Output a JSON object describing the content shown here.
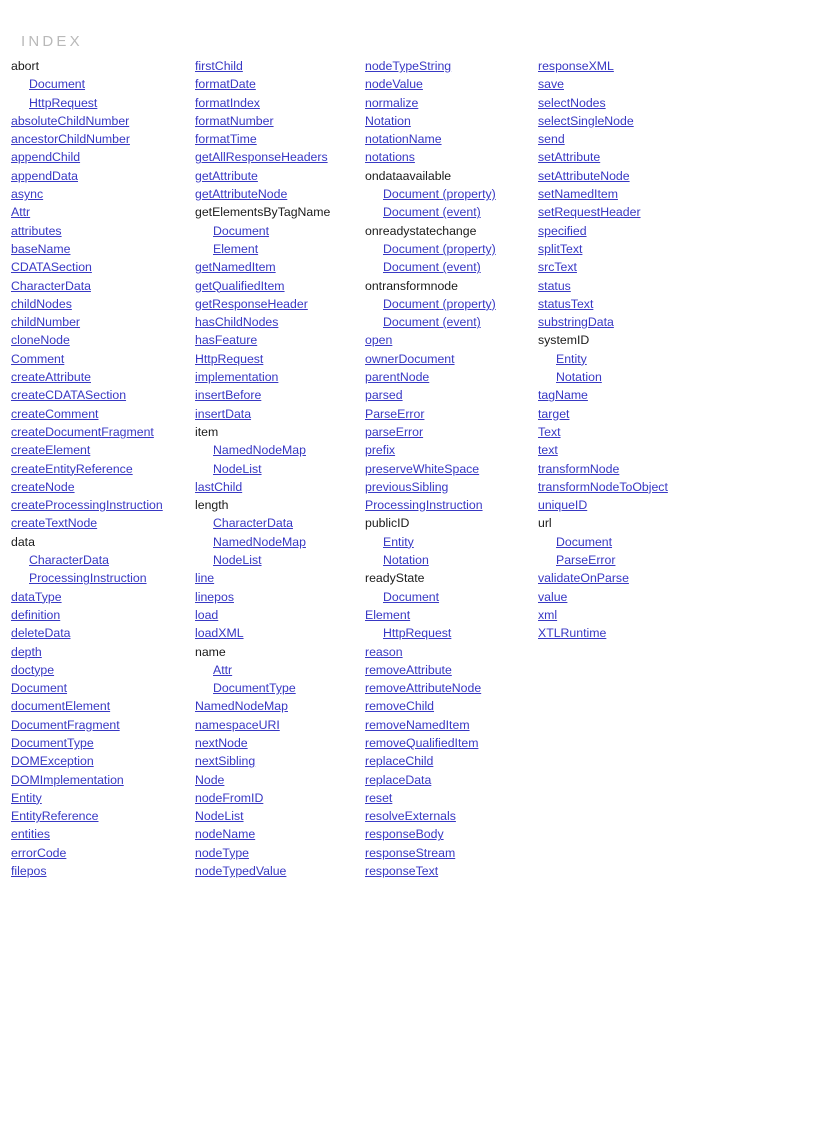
{
  "page": {
    "title": "INDEX",
    "link_color": "#3838c4",
    "text_color": "#1a1a1a",
    "title_color": "#b9b9b9",
    "background_color": "#ffffff"
  },
  "columns": [
    {
      "name": "column-1",
      "entries": [
        {
          "label": "abort",
          "link": false,
          "indent": 0
        },
        {
          "label": "Document",
          "link": true,
          "indent": 1
        },
        {
          "label": "HttpRequest",
          "link": true,
          "indent": 1
        },
        {
          "label": "absoluteChildNumber",
          "link": true,
          "indent": 0
        },
        {
          "label": "ancestorChildNumber",
          "link": true,
          "indent": 0
        },
        {
          "label": "appendChild",
          "link": true,
          "indent": 0
        },
        {
          "label": "appendData",
          "link": true,
          "indent": 0
        },
        {
          "label": "async",
          "link": true,
          "indent": 0
        },
        {
          "label": "Attr",
          "link": true,
          "indent": 0
        },
        {
          "label": "attributes",
          "link": true,
          "indent": 0
        },
        {
          "label": "baseName",
          "link": true,
          "indent": 0
        },
        {
          "label": "CDATASection",
          "link": true,
          "indent": 0
        },
        {
          "label": "CharacterData",
          "link": true,
          "indent": 0
        },
        {
          "label": "childNodes",
          "link": true,
          "indent": 0
        },
        {
          "label": "childNumber",
          "link": true,
          "indent": 0
        },
        {
          "label": "cloneNode",
          "link": true,
          "indent": 0
        },
        {
          "label": "Comment",
          "link": true,
          "indent": 0
        },
        {
          "label": "createAttribute",
          "link": true,
          "indent": 0
        },
        {
          "label": "createCDATASection",
          "link": true,
          "indent": 0
        },
        {
          "label": "createComment",
          "link": true,
          "indent": 0
        },
        {
          "label": "createDocumentFragment",
          "link": true,
          "indent": 0
        },
        {
          "label": "createElement",
          "link": true,
          "indent": 0
        },
        {
          "label": "createEntityReference",
          "link": true,
          "indent": 0
        },
        {
          "label": "createNode",
          "link": true,
          "indent": 0
        },
        {
          "label": "createProcessingInstruction",
          "link": true,
          "indent": 0
        },
        {
          "label": "createTextNode",
          "link": true,
          "indent": 0
        },
        {
          "label": "data",
          "link": false,
          "indent": 0
        },
        {
          "label": "CharacterData",
          "link": true,
          "indent": 1
        },
        {
          "label": "ProcessingInstruction",
          "link": true,
          "indent": 1
        },
        {
          "label": "dataType",
          "link": true,
          "indent": 0
        },
        {
          "label": "definition",
          "link": true,
          "indent": 0
        },
        {
          "label": "deleteData",
          "link": true,
          "indent": 0
        },
        {
          "label": "depth",
          "link": true,
          "indent": 0
        },
        {
          "label": "doctype",
          "link": true,
          "indent": 0
        },
        {
          "label": "Document",
          "link": true,
          "indent": 0
        },
        {
          "label": "documentElement",
          "link": true,
          "indent": 0
        },
        {
          "label": "DocumentFragment",
          "link": true,
          "indent": 0
        },
        {
          "label": "DocumentType",
          "link": true,
          "indent": 0
        },
        {
          "label": "DOMException",
          "link": true,
          "indent": 0
        },
        {
          "label": "DOMImplementation",
          "link": true,
          "indent": 0
        },
        {
          "label": "Entity",
          "link": true,
          "indent": 0
        },
        {
          "label": "EntityReference",
          "link": true,
          "indent": 0
        },
        {
          "label": "entities",
          "link": true,
          "indent": 0
        },
        {
          "label": "errorCode",
          "link": true,
          "indent": 0
        },
        {
          "label": "filepos",
          "link": true,
          "indent": 0
        }
      ]
    },
    {
      "name": "column-2",
      "entries": [
        {
          "label": "firstChild",
          "link": true,
          "indent": 0
        },
        {
          "label": "formatDate",
          "link": true,
          "indent": 0
        },
        {
          "label": "formatIndex",
          "link": true,
          "indent": 0
        },
        {
          "label": "formatNumber",
          "link": true,
          "indent": 0
        },
        {
          "label": "formatTime",
          "link": true,
          "indent": 0
        },
        {
          "label": "getAllResponseHeaders",
          "link": true,
          "indent": 0
        },
        {
          "label": "getAttribute",
          "link": true,
          "indent": 0
        },
        {
          "label": "getAttributeNode",
          "link": true,
          "indent": 0
        },
        {
          "label": "getElementsByTagName",
          "link": false,
          "indent": 0
        },
        {
          "label": "Document",
          "link": true,
          "indent": 1
        },
        {
          "label": "Element",
          "link": true,
          "indent": 1
        },
        {
          "label": "getNamedItem",
          "link": true,
          "indent": 0
        },
        {
          "label": "getQualifiedItem",
          "link": true,
          "indent": 0
        },
        {
          "label": "getResponseHeader",
          "link": true,
          "indent": 0
        },
        {
          "label": "hasChildNodes",
          "link": true,
          "indent": 0
        },
        {
          "label": "hasFeature",
          "link": true,
          "indent": 0
        },
        {
          "label": "HttpRequest",
          "link": true,
          "indent": 0
        },
        {
          "label": "implementation",
          "link": true,
          "indent": 0
        },
        {
          "label": "insertBefore",
          "link": true,
          "indent": 0
        },
        {
          "label": "insertData",
          "link": true,
          "indent": 0
        },
        {
          "label": "item",
          "link": false,
          "indent": 0
        },
        {
          "label": "NamedNodeMap",
          "link": true,
          "indent": 1
        },
        {
          "label": "NodeList",
          "link": true,
          "indent": 1
        },
        {
          "label": "lastChild",
          "link": true,
          "indent": 0
        },
        {
          "label": "length",
          "link": false,
          "indent": 0
        },
        {
          "label": "CharacterData",
          "link": true,
          "indent": 1
        },
        {
          "label": "NamedNodeMap",
          "link": true,
          "indent": 1
        },
        {
          "label": "NodeList",
          "link": true,
          "indent": 1
        },
        {
          "label": "line",
          "link": true,
          "indent": 0
        },
        {
          "label": "linepos",
          "link": true,
          "indent": 0
        },
        {
          "label": "load",
          "link": true,
          "indent": 0
        },
        {
          "label": "loadXML",
          "link": true,
          "indent": 0
        },
        {
          "label": "name",
          "link": false,
          "indent": 0
        },
        {
          "label": "Attr",
          "link": true,
          "indent": 1
        },
        {
          "label": "DocumentType",
          "link": true,
          "indent": 1
        },
        {
          "label": "NamedNodeMap",
          "link": true,
          "indent": 0
        },
        {
          "label": "namespaceURI",
          "link": true,
          "indent": 0
        },
        {
          "label": "nextNode",
          "link": true,
          "indent": 0
        },
        {
          "label": "nextSibling",
          "link": true,
          "indent": 0
        },
        {
          "label": "Node",
          "link": true,
          "indent": 0
        },
        {
          "label": "nodeFromID",
          "link": true,
          "indent": 0
        },
        {
          "label": "NodeList",
          "link": true,
          "indent": 0
        },
        {
          "label": "nodeName",
          "link": true,
          "indent": 0
        },
        {
          "label": "nodeType",
          "link": true,
          "indent": 0
        },
        {
          "label": "nodeTypedValue",
          "link": true,
          "indent": 0
        }
      ]
    },
    {
      "name": "column-3",
      "entries": [
        {
          "label": "nodeTypeString",
          "link": true,
          "indent": 0
        },
        {
          "label": "nodeValue",
          "link": true,
          "indent": 0
        },
        {
          "label": "normalize",
          "link": true,
          "indent": 0
        },
        {
          "label": "Notation",
          "link": true,
          "indent": 0
        },
        {
          "label": "notationName",
          "link": true,
          "indent": 0
        },
        {
          "label": "notations",
          "link": true,
          "indent": 0
        },
        {
          "label": "ondataavailable",
          "link": false,
          "indent": 0
        },
        {
          "label": "Document (property)",
          "link": true,
          "indent": 1
        },
        {
          "label": "Document (event)",
          "link": true,
          "indent": 1
        },
        {
          "label": "onreadystatechange",
          "link": false,
          "indent": 0
        },
        {
          "label": "Document (property)",
          "link": true,
          "indent": 1
        },
        {
          "label": "Document (event)",
          "link": true,
          "indent": 1
        },
        {
          "label": "ontransformnode",
          "link": false,
          "indent": 0
        },
        {
          "label": "Document (property)",
          "link": true,
          "indent": 1
        },
        {
          "label": "Document (event)",
          "link": true,
          "indent": 1
        },
        {
          "label": "open",
          "link": true,
          "indent": 0
        },
        {
          "label": "ownerDocument",
          "link": true,
          "indent": 0
        },
        {
          "label": "parentNode",
          "link": true,
          "indent": 0
        },
        {
          "label": "parsed",
          "link": true,
          "indent": 0
        },
        {
          "label": "ParseError",
          "link": true,
          "indent": 0
        },
        {
          "label": "parseError",
          "link": true,
          "indent": 0
        },
        {
          "label": "prefix",
          "link": true,
          "indent": 0
        },
        {
          "label": "preserveWhiteSpace",
          "link": true,
          "indent": 0
        },
        {
          "label": "previousSibling",
          "link": true,
          "indent": 0
        },
        {
          "label": "ProcessingInstruction",
          "link": true,
          "indent": 0
        },
        {
          "label": "publicID",
          "link": false,
          "indent": 0
        },
        {
          "label": "Entity",
          "link": true,
          "indent": 1
        },
        {
          "label": "Notation",
          "link": true,
          "indent": 1
        },
        {
          "label": "readyState",
          "link": false,
          "indent": 0
        },
        {
          "label": "Document",
          "link": true,
          "indent": 1
        },
        {
          "label": "Element",
          "link": true,
          "indent": 0
        },
        {
          "label": "HttpRequest",
          "link": true,
          "indent": 1
        },
        {
          "label": "reason",
          "link": true,
          "indent": 0
        },
        {
          "label": "removeAttribute",
          "link": true,
          "indent": 0
        },
        {
          "label": "removeAttributeNode",
          "link": true,
          "indent": 0
        },
        {
          "label": "removeChild",
          "link": true,
          "indent": 0
        },
        {
          "label": "removeNamedItem",
          "link": true,
          "indent": 0
        },
        {
          "label": "removeQualifiedItem",
          "link": true,
          "indent": 0
        },
        {
          "label": "replaceChild",
          "link": true,
          "indent": 0
        },
        {
          "label": "replaceData",
          "link": true,
          "indent": 0
        },
        {
          "label": "reset",
          "link": true,
          "indent": 0
        },
        {
          "label": "resolveExternals",
          "link": true,
          "indent": 0
        },
        {
          "label": "responseBody",
          "link": true,
          "indent": 0
        },
        {
          "label": "responseStream",
          "link": true,
          "indent": 0
        },
        {
          "label": "responseText",
          "link": true,
          "indent": 0
        }
      ]
    },
    {
      "name": "column-4",
      "entries": [
        {
          "label": "responseXML",
          "link": true,
          "indent": 0
        },
        {
          "label": "save",
          "link": true,
          "indent": 0
        },
        {
          "label": "selectNodes",
          "link": true,
          "indent": 0
        },
        {
          "label": "selectSingleNode",
          "link": true,
          "indent": 0
        },
        {
          "label": "send",
          "link": true,
          "indent": 0
        },
        {
          "label": "setAttribute",
          "link": true,
          "indent": 0
        },
        {
          "label": "setAttributeNode",
          "link": true,
          "indent": 0
        },
        {
          "label": "setNamedItem",
          "link": true,
          "indent": 0
        },
        {
          "label": "setRequestHeader",
          "link": true,
          "indent": 0
        },
        {
          "label": "specified",
          "link": true,
          "indent": 0
        },
        {
          "label": "splitText",
          "link": true,
          "indent": 0
        },
        {
          "label": "srcText",
          "link": true,
          "indent": 0
        },
        {
          "label": "status",
          "link": true,
          "indent": 0
        },
        {
          "label": "statusText",
          "link": true,
          "indent": 0
        },
        {
          "label": "substringData",
          "link": true,
          "indent": 0
        },
        {
          "label": "systemID",
          "link": false,
          "indent": 0
        },
        {
          "label": "Entity",
          "link": true,
          "indent": 1
        },
        {
          "label": "Notation",
          "link": true,
          "indent": 1
        },
        {
          "label": "tagName",
          "link": true,
          "indent": 0
        },
        {
          "label": "target",
          "link": true,
          "indent": 0
        },
        {
          "label": "Text",
          "link": true,
          "indent": 0
        },
        {
          "label": "text",
          "link": true,
          "indent": 0
        },
        {
          "label": "transformNode",
          "link": true,
          "indent": 0
        },
        {
          "label": "transformNodeToObject",
          "link": true,
          "indent": 0
        },
        {
          "label": "uniqueID",
          "link": true,
          "indent": 0
        },
        {
          "label": "url",
          "link": false,
          "indent": 0
        },
        {
          "label": "Document",
          "link": true,
          "indent": 1
        },
        {
          "label": "ParseError",
          "link": true,
          "indent": 1
        },
        {
          "label": "validateOnParse",
          "link": true,
          "indent": 0
        },
        {
          "label": "value",
          "link": true,
          "indent": 0
        },
        {
          "label": "xml",
          "link": true,
          "indent": 0
        },
        {
          "label": "XTLRuntime",
          "link": true,
          "indent": 0
        }
      ]
    }
  ]
}
